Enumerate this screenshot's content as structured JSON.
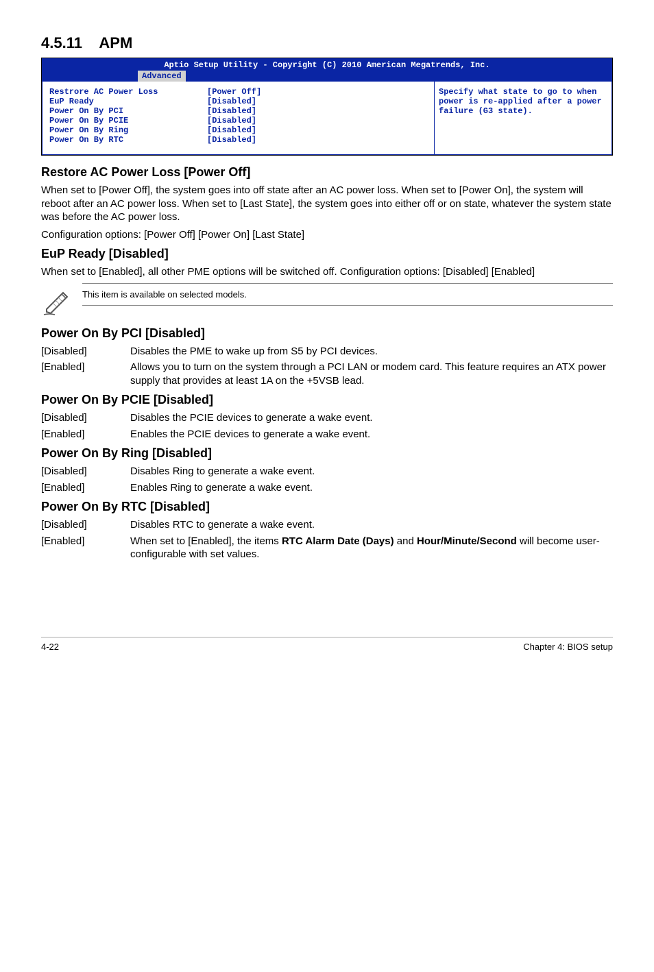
{
  "section": {
    "number": "4.5.11",
    "title": "APM"
  },
  "bios": {
    "header_line1": "Aptio Setup Utility - Copyright (C) 2010 American Megatrends, Inc.",
    "tab": "Advanced",
    "rows": [
      {
        "label": "Restrore AC Power Loss",
        "value": "[Power Off]"
      },
      {
        "label": "EuP Ready",
        "value": "[Disabled]"
      },
      {
        "label": "Power On By PCI",
        "value": "[Disabled]"
      },
      {
        "label": "Power On By PCIE",
        "value": "[Disabled]"
      },
      {
        "label": "Power On By Ring",
        "value": "[Disabled]"
      },
      {
        "label": "Power On By RTC",
        "value": "[Disabled]"
      }
    ],
    "help": "Specify what state to go to when power is re-applied after a power failure (G3 state)."
  },
  "restore": {
    "heading": "Restore AC Power Loss [Power Off]",
    "p1": "When set to [Power Off], the system goes into off state after an AC power loss. When set to [Power On], the system will reboot after an AC power loss. When set to [Last State], the system goes into either off or on state, whatever the system state was before the AC power loss.",
    "p2": "Configuration options: [Power Off] [Power On] [Last State]"
  },
  "eup": {
    "heading": "EuP Ready [Disabled]",
    "p1": "When set to [Enabled], all other PME options will be switched off. Configuration options: [Disabled] [Enabled]",
    "note": "This item is available on selected models."
  },
  "pci": {
    "heading": "Power On By PCI [Disabled]",
    "opt1_label": "[Disabled]",
    "opt1_desc": "Disables the PME to wake up from S5 by PCI devices.",
    "opt2_label": "[Enabled]",
    "opt2_desc": "Allows you to turn on the system through a PCI LAN or modem card. This feature requires an ATX power supply that provides at least 1A on the +5VSB lead."
  },
  "pcie": {
    "heading": "Power On By PCIE [Disabled]",
    "opt1_label": "[Disabled]",
    "opt1_desc": "Disables the PCIE devices to generate a wake event.",
    "opt2_label": "[Enabled]",
    "opt2_desc": "Enables the PCIE devices to generate a wake event."
  },
  "ring": {
    "heading": "Power On By Ring [Disabled]",
    "opt1_label": "[Disabled]",
    "opt1_desc": "Disables Ring to generate a wake event.",
    "opt2_label": "[Enabled]",
    "opt2_desc": "Enables Ring to generate a wake event."
  },
  "rtc": {
    "heading": "Power On By RTC [Disabled]",
    "opt1_label": "[Disabled]",
    "opt1_desc": "Disables RTC to generate a wake event.",
    "opt2_label": "[Enabled]",
    "opt2_desc_pre": "When set to [Enabled], the items ",
    "opt2_bold1": "RTC Alarm Date (Days)",
    "opt2_mid": " and ",
    "opt2_bold2": "Hour/Minute/Second",
    "opt2_desc_post": " will become user-configurable with set values."
  },
  "footer": {
    "left": "4-22",
    "right": "Chapter 4: BIOS setup"
  }
}
